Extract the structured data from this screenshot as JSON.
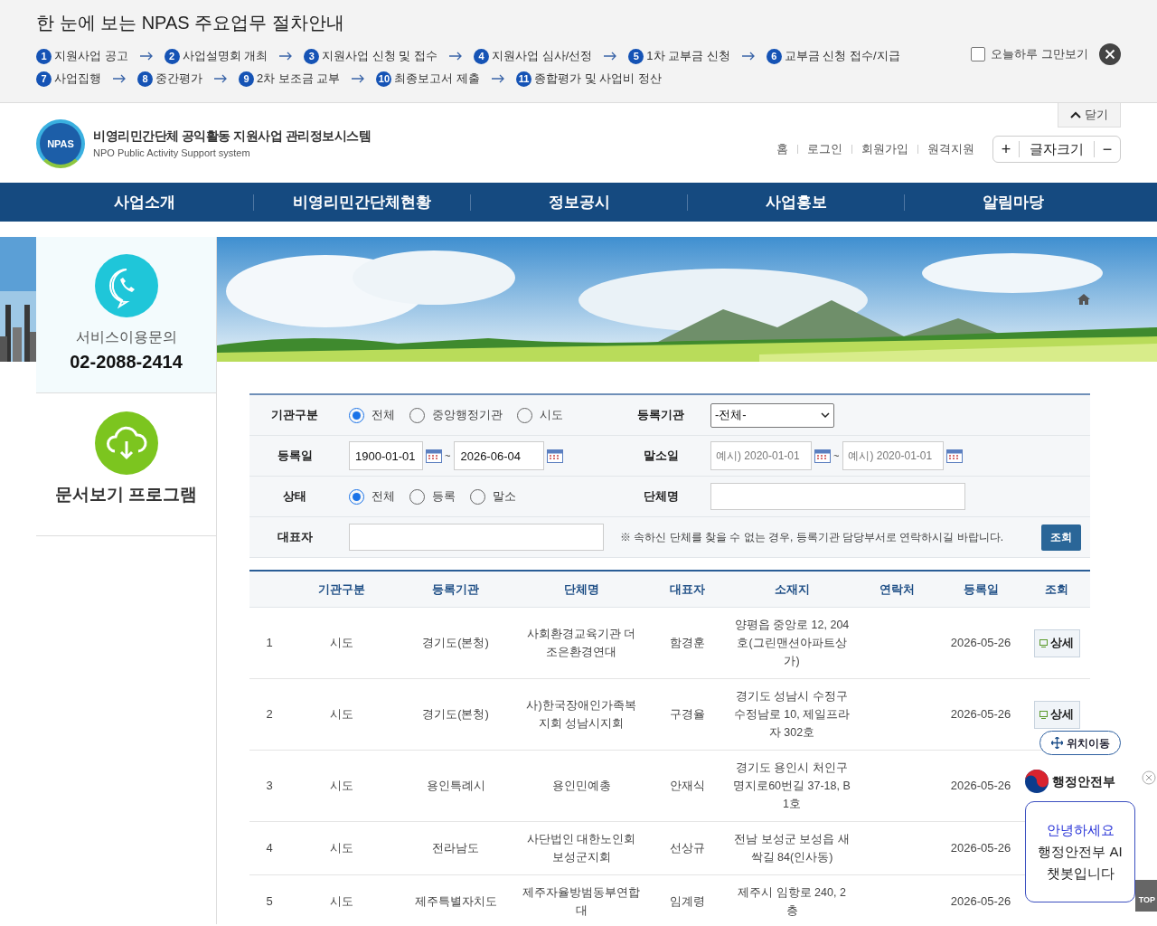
{
  "notice": {
    "title": "한 눈에 보는 NPAS 주요업무 절차안내",
    "steps": [
      {
        "num": "1",
        "label": "지원사업 공고"
      },
      {
        "num": "2",
        "label": "사업설명회 개최"
      },
      {
        "num": "3",
        "label": "지원사업 신청 및 접수"
      },
      {
        "num": "4",
        "label": "지원사업 심사/선정"
      },
      {
        "num": "5",
        "label": "1차 교부금 신청"
      },
      {
        "num": "6",
        "label": "교부금 신청 접수/지급"
      },
      {
        "num": "7",
        "label": "사업집행"
      },
      {
        "num": "8",
        "label": "중간평가"
      },
      {
        "num": "9",
        "label": "2차 보조금 교부"
      },
      {
        "num": "10",
        "label": "최종보고서 제출"
      },
      {
        "num": "11",
        "label": "종합평가 및 사업비 정산"
      }
    ],
    "dismiss": {
      "label": "오늘하루 그만보기",
      "checked": false
    },
    "close_tab": "닫기"
  },
  "header": {
    "logo_badge": "NPAS",
    "logo_title": "비영리민간단체 공익활동 지원사업 관리정보시스템",
    "logo_subtitle": "NPO Public Activity Support system",
    "links": [
      "홈",
      "로그인",
      "회원가입",
      "원격지원"
    ],
    "font_size": {
      "plus": "+",
      "label": "글자크기",
      "minus": "−"
    }
  },
  "nav": [
    "사업소개",
    "비영리민간단체현황",
    "정보공시",
    "사업홍보",
    "알림마당"
  ],
  "sidebar": {
    "service_label": "서비스이용문의",
    "phone": "02-2088-2414",
    "viewer": "문서보기 프로그램"
  },
  "search": {
    "rows": [
      {
        "fields": [
          {
            "label": "기관구분",
            "kind": "radio",
            "options": [
              {
                "label": "전체",
                "selected": true
              },
              {
                "label": "중앙행정기관",
                "selected": false
              },
              {
                "label": "시도",
                "selected": false
              }
            ]
          },
          {
            "label": "등록기관",
            "kind": "select",
            "value": "-전체-"
          }
        ]
      },
      {
        "fields": [
          {
            "label": "등록일",
            "kind": "daterange",
            "from": "1900-01-01",
            "separator": "~",
            "to": "2026-06-04"
          },
          {
            "label": "말소일",
            "kind": "daterange",
            "placeholder_from": "예시) 2020-01-01",
            "separator": "~",
            "placeholder_to": "예시) 2020-01-01"
          }
        ]
      },
      {
        "fields": [
          {
            "label": "상태",
            "kind": "radio",
            "options": [
              {
                "label": "전체",
                "selected": true
              },
              {
                "label": "등록",
                "selected": false
              },
              {
                "label": "말소",
                "selected": false
              }
            ]
          },
          {
            "label": "단체명",
            "kind": "text"
          }
        ]
      },
      {
        "fields": [
          {
            "label": "대표자",
            "kind": "text"
          }
        ],
        "note": "※ 속하신 단체를 찾을 수 없는 경우, 등록기관 담당부서로 연락하시길 바랍니다.",
        "button": "조회"
      }
    ]
  },
  "table": {
    "columns": [
      "기관구분",
      "등록기관",
      "단체명",
      "대표자",
      "소재지",
      "연락처",
      "등록일",
      "조회"
    ],
    "rows": [
      {
        "no": "1",
        "type": "시도",
        "agency": "경기도(본청)",
        "name": "사회환경교육기관 더 조은환경연대",
        "rep": "함경훈",
        "address": "양평읍 중앙로 12, 204호(그린맨션아파트상가)",
        "date": "2026-05-26",
        "detail": "상세"
      },
      {
        "no": "2",
        "type": "시도",
        "agency": "경기도(본청)",
        "name": "사)한국장애인가족복지회 성남시지회",
        "rep": "구경율",
        "address": "경기도 성남시 수정구 수정남로 10, 제일프라자 302호",
        "date": "2026-05-26",
        "detail": "상세"
      },
      {
        "no": "3",
        "type": "시도",
        "agency": "용인특례시",
        "name": "용인민예총",
        "rep": "안재식",
        "address": "경기도 용인시 처인구 명지로60번길 37-18, B1호",
        "date": "2026-05-26"
      },
      {
        "no": "4",
        "type": "시도",
        "agency": "전라남도",
        "name": "사단법인 대한노인회 보성군지회",
        "rep": "선상규",
        "address": "전남 보성군 보성읍 새싹길 84(인사동)",
        "date": "2026-05-26"
      },
      {
        "no": "5",
        "type": "시도",
        "agency": "제주특별자치도",
        "name": "제주자율방범동부연합대",
        "rep": "임계령",
        "address": "제주시 임항로 240, 2층",
        "date": "2026-05-26"
      }
    ]
  },
  "floating": {
    "move": "위치이동",
    "ministry": "행정안전부",
    "chat_greeting": "안녕하세요",
    "chat_text": "행정안전부 AI챗봇입니다",
    "top": "TOP"
  }
}
